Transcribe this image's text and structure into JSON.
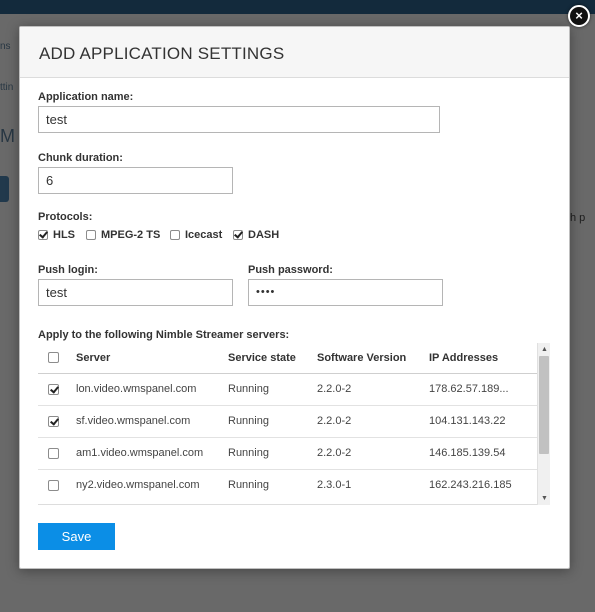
{
  "background": {
    "fragments": [
      "ns",
      "ttin",
      "M",
      "h p"
    ]
  },
  "dialog": {
    "title": "ADD APPLICATION SETTINGS",
    "close_symbol": "×",
    "app_name": {
      "label": "Application name:",
      "value": "test"
    },
    "chunk_duration": {
      "label": "Chunk duration:",
      "value": "6"
    },
    "protocols": {
      "label": "Protocols:",
      "items": [
        {
          "label": "HLS",
          "checked": true
        },
        {
          "label": "MPEG-2 TS",
          "checked": false
        },
        {
          "label": "Icecast",
          "checked": false
        },
        {
          "label": "DASH",
          "checked": true
        }
      ]
    },
    "push_login": {
      "label": "Push login:",
      "value": "test"
    },
    "push_password": {
      "label": "Push password:",
      "value": "••••"
    },
    "servers": {
      "label": "Apply to the following Nimble Streamer servers:",
      "columns": [
        "Server",
        "Service state",
        "Software Version",
        "IP Addresses"
      ],
      "rows": [
        {
          "server": "lon.video.wmspanel.com",
          "state": "Running",
          "version": "2.2.0-2",
          "ip": "178.62.57.189...",
          "checked": true
        },
        {
          "server": "sf.video.wmspanel.com",
          "state": "Running",
          "version": "2.2.0-2",
          "ip": "104.131.143.22",
          "checked": true
        },
        {
          "server": "am1.video.wmspanel.com",
          "state": "Running",
          "version": "2.2.0-2",
          "ip": "146.185.139.54",
          "checked": false
        },
        {
          "server": "ny2.video.wmspanel.com",
          "state": "Running",
          "version": "2.3.0-1",
          "ip": "162.243.216.185",
          "checked": false
        }
      ]
    },
    "save_label": "Save"
  },
  "colors": {
    "accent": "#0b8ee6",
    "header_bg": "#f6f6f6",
    "topbar": "#2c5e86"
  },
  "icons": {
    "close": "close-icon",
    "scroll_up": "arrow-up-icon",
    "scroll_down": "arrow-down-icon",
    "checkbox": "checkbox-icon"
  }
}
